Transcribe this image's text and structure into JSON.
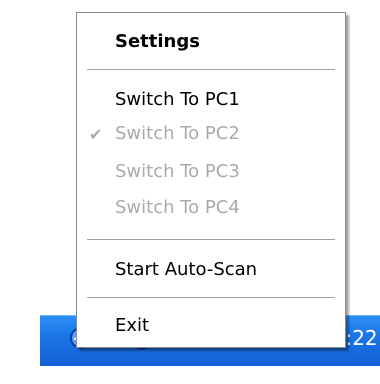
{
  "menu": {
    "settings": "Settings",
    "switch_pc1": "Switch To PC1",
    "switch_pc2": "Switch To PC2",
    "switch_pc3": "Switch To PC3",
    "switch_pc4": "Switch To PC4",
    "start_auto_scan": "Start Auto-Scan",
    "exit": "Exit",
    "checked_glyph": "✔"
  },
  "tray": {
    "clock": "11:22",
    "icons": [
      "network-icon",
      "antivirus-icon",
      "bluetooth-icon",
      "keyboard-icon",
      "language-icon",
      "pdf-icon"
    ]
  },
  "colors": {
    "taskbar_blue": "#1b74e6",
    "disabled_text": "#aaaaaa"
  }
}
